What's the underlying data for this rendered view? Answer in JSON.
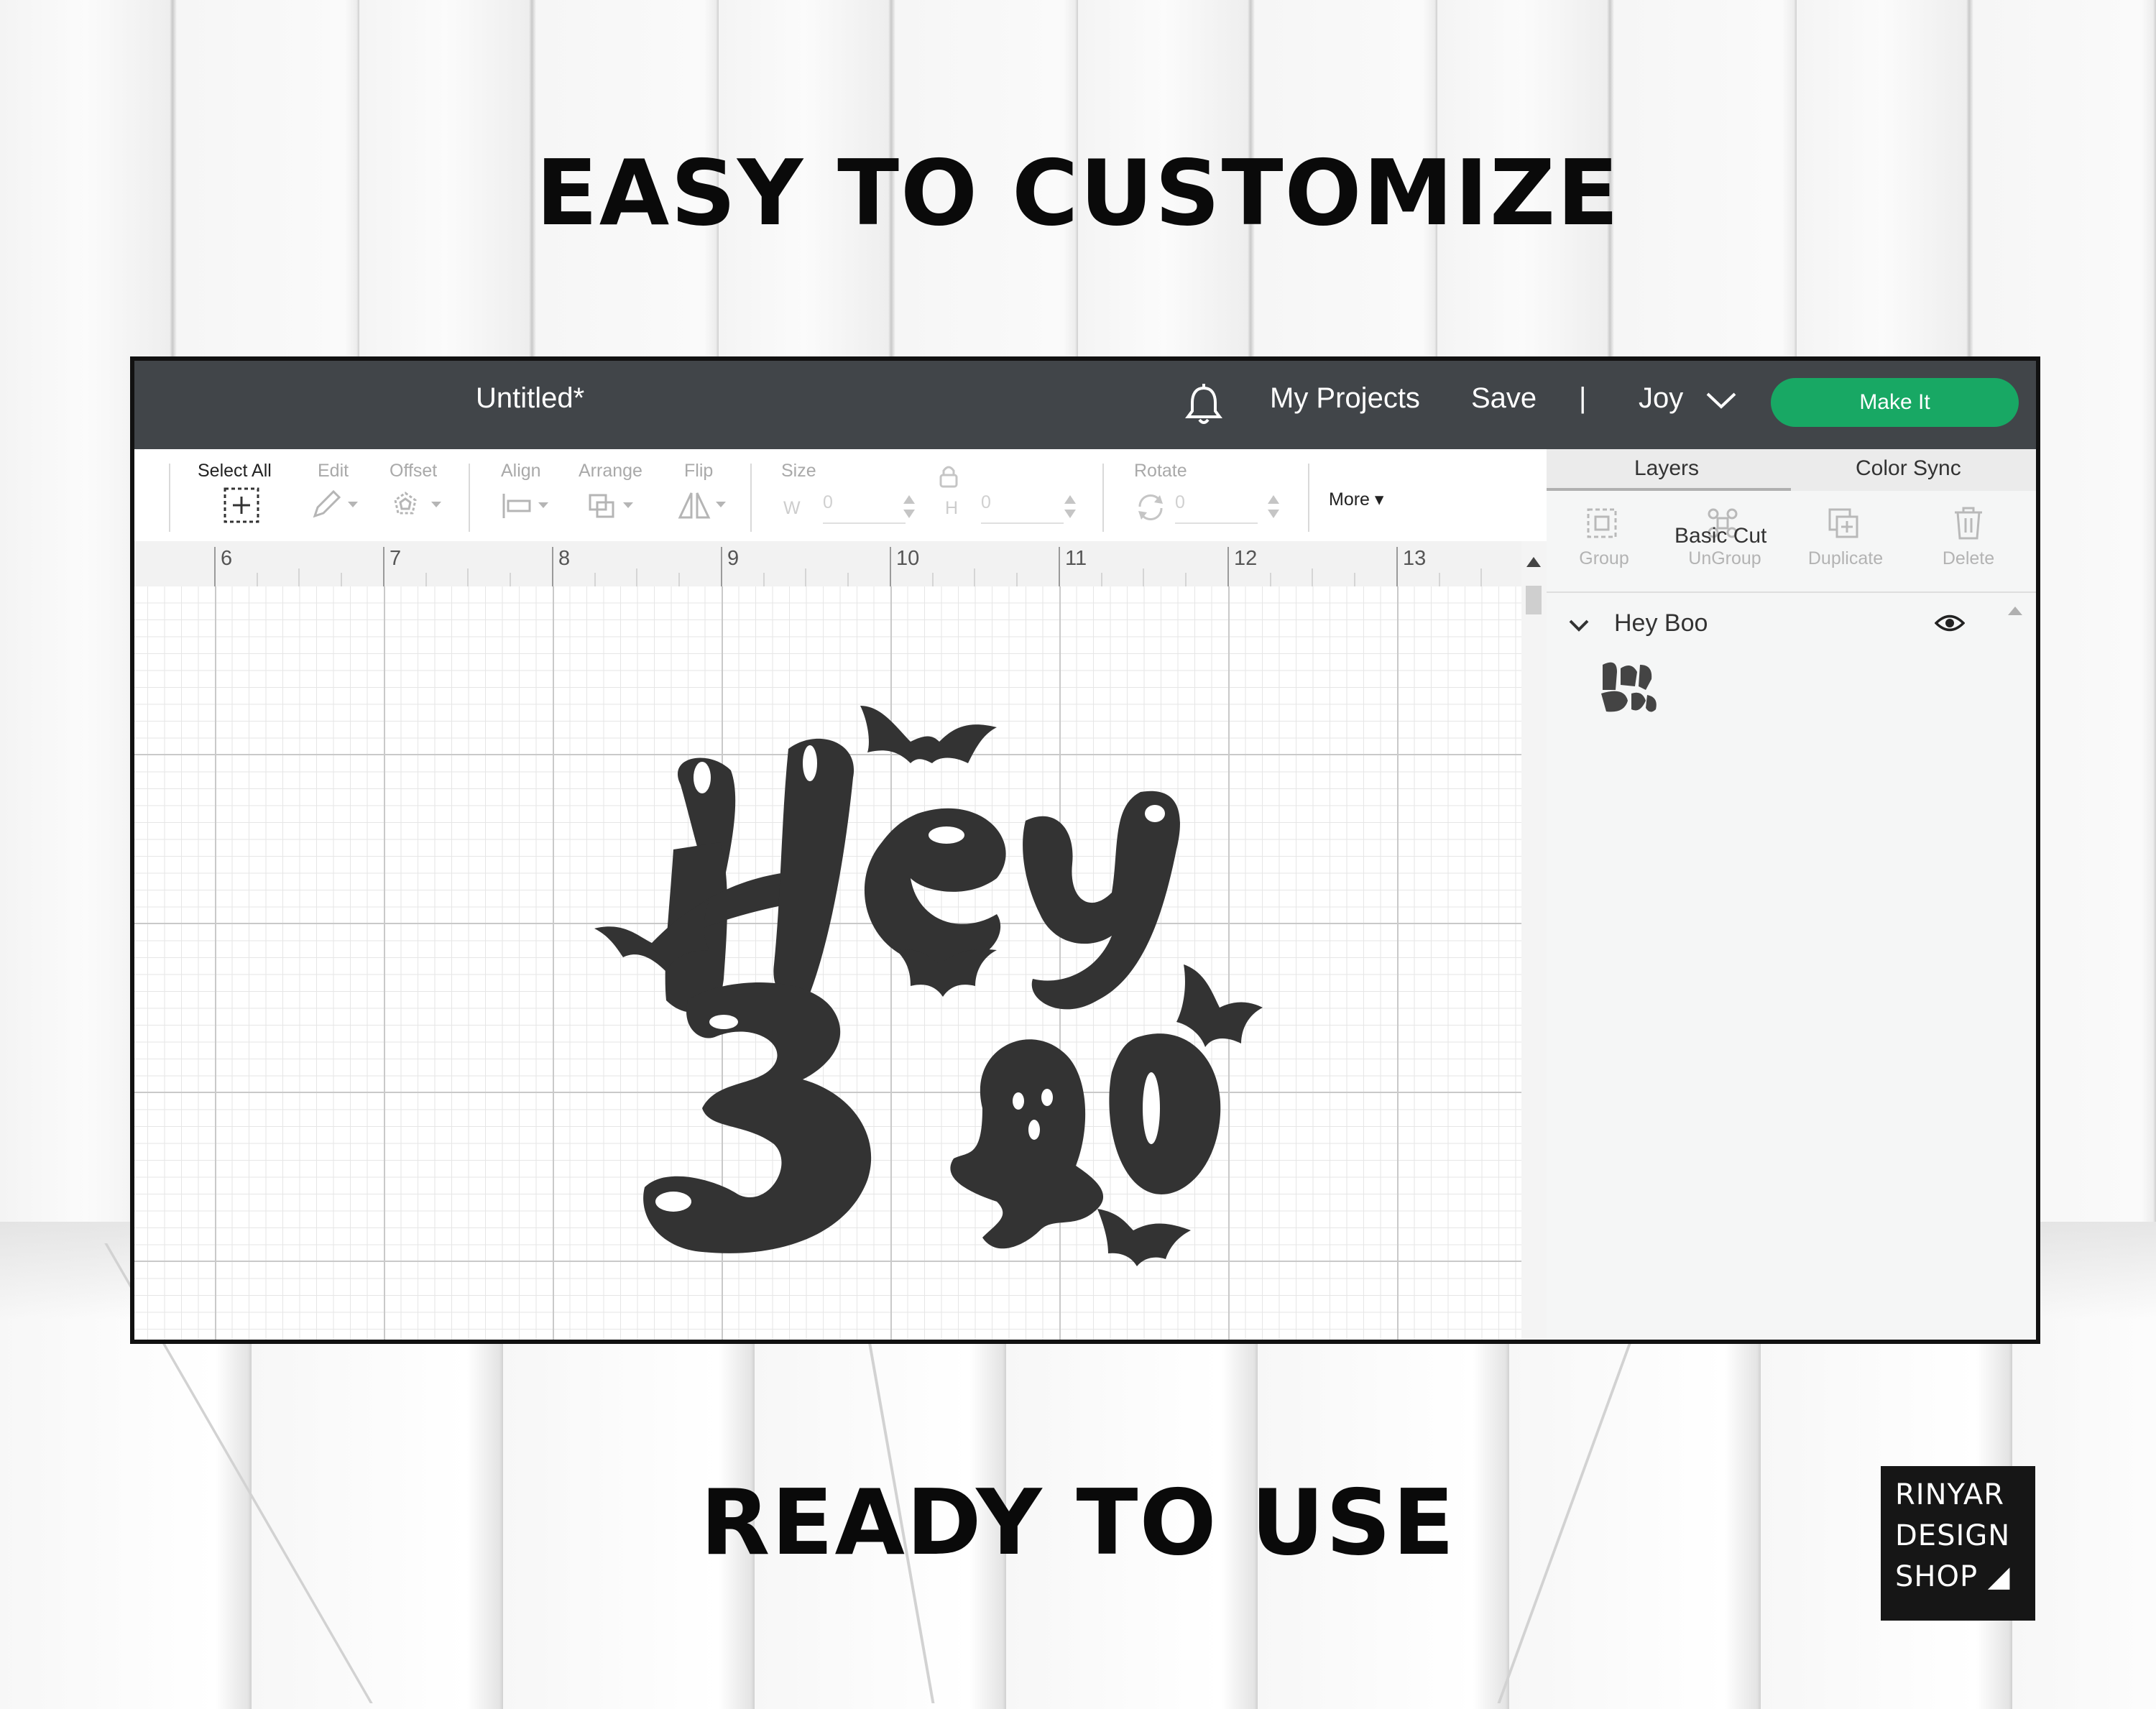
{
  "headline_top": "EASY TO CUSTOMIZE",
  "headline_bottom": "READY TO USE",
  "app": {
    "doc_title": "Untitled*",
    "nav": {
      "projects": "My Projects",
      "save": "Save",
      "separator": "|",
      "user": "Joy"
    },
    "make_it": "Make It",
    "accent_color": "#18a864",
    "toolbar": {
      "select_all": "Select All",
      "edit": "Edit",
      "offset": "Offset",
      "align": "Align",
      "arrange": "Arrange",
      "flip": "Flip",
      "size": "Size",
      "w_label": "W",
      "w_value": "0",
      "h_label": "H",
      "h_value": "0",
      "rotate": "Rotate",
      "rotate_value": "0",
      "more": "More"
    },
    "ruler": [
      "6",
      "7",
      "8",
      "9",
      "10",
      "11",
      "12",
      "13"
    ],
    "panel": {
      "tabs": [
        "Layers",
        "Color Sync"
      ],
      "actions": [
        "Group",
        "UnGroup",
        "Duplicate",
        "Delete"
      ],
      "group_name": "Hey Boo",
      "layer_name": "Basic Cut"
    }
  },
  "logo": {
    "line1": "RINYAR",
    "line2": "DESIGN",
    "line3": "SHOP"
  }
}
